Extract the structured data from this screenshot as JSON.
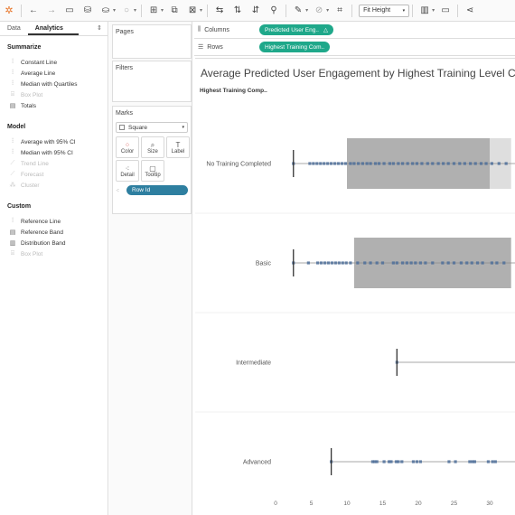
{
  "toolbar": {
    "fit_label": "Fit Height",
    "icons": [
      "tableau-logo-icon",
      "back-icon",
      "forward-icon",
      "save-icon",
      "new-datasource-icon",
      "datasource-icon",
      "refresh-icon",
      "new-worksheet-icon",
      "duplicate-icon",
      "clear-icon",
      "swap-icon",
      "sort-asc-icon",
      "sort-desc-icon",
      "highlight-icon",
      "group-icon",
      "pin-icon",
      "fit-icon",
      "show-me-icon",
      "presentation-icon",
      "share-icon"
    ]
  },
  "left_panel": {
    "tabs": [
      "Data",
      "Analytics"
    ],
    "active_tab": "Analytics",
    "sections": [
      {
        "title": "Summarize",
        "items": [
          {
            "label": "Constant Line",
            "enabled": true,
            "icon": "constant-line-icon"
          },
          {
            "label": "Average Line",
            "enabled": true,
            "icon": "average-line-icon"
          },
          {
            "label": "Median with Quartiles",
            "enabled": true,
            "icon": "median-quartiles-icon"
          },
          {
            "label": "Box Plot",
            "enabled": false,
            "icon": "box-plot-icon"
          },
          {
            "label": "Totals",
            "enabled": true,
            "icon": "totals-icon"
          }
        ]
      },
      {
        "title": "Model",
        "items": [
          {
            "label": "Average with 95% CI",
            "enabled": true,
            "icon": "average-ci-icon"
          },
          {
            "label": "Median with 95% CI",
            "enabled": true,
            "icon": "median-ci-icon"
          },
          {
            "label": "Trend Line",
            "enabled": false,
            "icon": "trend-line-icon"
          },
          {
            "label": "Forecast",
            "enabled": false,
            "icon": "forecast-icon"
          },
          {
            "label": "Cluster",
            "enabled": false,
            "icon": "cluster-icon"
          }
        ]
      },
      {
        "title": "Custom",
        "items": [
          {
            "label": "Reference Line",
            "enabled": true,
            "icon": "reference-line-icon"
          },
          {
            "label": "Reference Band",
            "enabled": true,
            "icon": "reference-band-icon"
          },
          {
            "label": "Distribution Band",
            "enabled": true,
            "icon": "distribution-band-icon"
          },
          {
            "label": "Box Plot",
            "enabled": false,
            "icon": "box-plot-icon"
          }
        ]
      }
    ]
  },
  "cards": {
    "pages_label": "Pages",
    "filters_label": "Filters",
    "marks_label": "Marks",
    "mark_type": "Square",
    "mark_buttons": [
      {
        "label": "Color",
        "icon": "color-icon"
      },
      {
        "label": "Size",
        "icon": "size-icon"
      },
      {
        "label": "Label",
        "icon": "label-icon"
      },
      {
        "label": "Detail",
        "icon": "detail-icon"
      },
      {
        "label": "Tooltip",
        "icon": "tooltip-icon"
      }
    ],
    "detail_pill": "Row Id"
  },
  "shelves": {
    "columns_label": "Columns",
    "columns_pill": "Predicted User Eng..",
    "rows_label": "Rows",
    "rows_pill": "Highest Training Com.."
  },
  "viz": {
    "title": "Average Predicted User Engagement by Highest Training Level C",
    "row_header": "Highest Training Comp.."
  },
  "chart_data": {
    "type": "scatter",
    "title": "Average Predicted User Engagement by Highest Training Level C",
    "xlabel": "",
    "ylabel": "Highest Training Comp..",
    "categories": [
      "No Training Completed",
      "Basic",
      "Intermediate",
      "Advanced"
    ],
    "xlim": [
      0,
      33
    ],
    "xticks": [
      0,
      5,
      10,
      15,
      20,
      25,
      30
    ],
    "colors": {
      "mark": "#4e6e9a",
      "band_dark": "#b0b0b0",
      "band_light": "#dedede",
      "ref_line": "#333333"
    },
    "rows": [
      {
        "category": "No Training Completed",
        "ref": 2.5,
        "band_dark": [
          10,
          30
        ],
        "band_light": [
          30,
          33
        ],
        "points": [
          2.5,
          4.8,
          5.3,
          5.8,
          6.3,
          6.8,
          7.3,
          7.8,
          8.3,
          8.8,
          9.3,
          9.8,
          10.5,
          11,
          11.6,
          12.2,
          12.8,
          13.3,
          14,
          14.5,
          15.2,
          16,
          16.5,
          17.2,
          17.8,
          18.5,
          19.2,
          19.8,
          20.5,
          21.3,
          22,
          22.8,
          23.5,
          24.2,
          25,
          25.8,
          26.5,
          27.3,
          28,
          28.8,
          29.5,
          30.3,
          31.3,
          32.3
        ]
      },
      {
        "category": "Basic",
        "ref": 2.5,
        "band_dark": [
          11,
          33
        ],
        "band_light": null,
        "points": [
          2.5,
          4.6,
          5.9,
          6.4,
          6.9,
          7.4,
          7.9,
          8.4,
          8.9,
          9.4,
          9.9,
          10.5,
          11.5,
          12.5,
          13.3,
          14.2,
          15,
          16.5,
          17,
          17.8,
          18.4,
          19,
          19.6,
          20.3,
          21,
          22,
          23.4,
          24.2,
          25,
          26,
          26.8,
          27.5,
          28.3,
          29,
          30.3,
          31,
          32
        ]
      },
      {
        "category": "Intermediate",
        "ref": 17,
        "band_dark": null,
        "band_light": null,
        "points": [
          17
        ]
      },
      {
        "category": "Advanced",
        "ref": 7.8,
        "band_dark": null,
        "band_light": null,
        "points": [
          7.8,
          13.6,
          13.9,
          14.2,
          15.2,
          15.9,
          16.2,
          16.9,
          17.2,
          17.7,
          19.3,
          19.8,
          20.3,
          24.3,
          25.2,
          27.2,
          27.6,
          27.9,
          29.8,
          30.4,
          30.8
        ]
      }
    ]
  }
}
